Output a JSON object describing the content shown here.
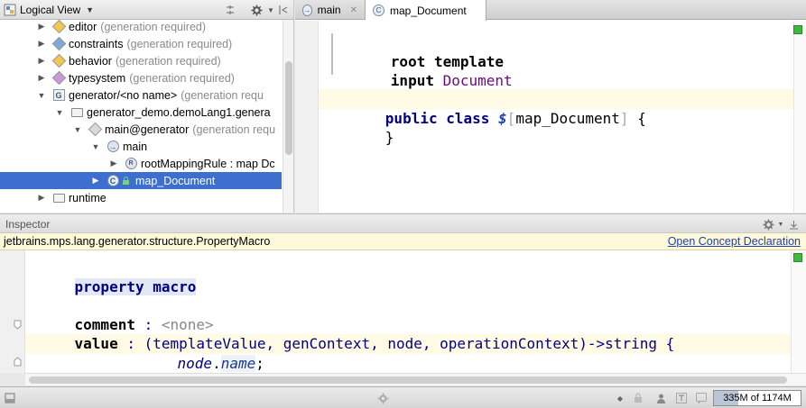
{
  "project": {
    "view_label": "Logical View",
    "tree": [
      {
        "name": "editor",
        "hint": "(generation required)",
        "icon": "module-diamond-icon",
        "badge": "E",
        "color": "#f0c850",
        "state": "collapsed"
      },
      {
        "name": "constraints",
        "hint": "(generation required)",
        "icon": "module-diamond-icon",
        "badge": "C",
        "color": "#7fa8d8",
        "state": "collapsed"
      },
      {
        "name": "behavior",
        "hint": "(generation required)",
        "icon": "module-diamond-icon",
        "badge": "B",
        "color": "#f0c850",
        "state": "collapsed"
      },
      {
        "name": "typesystem",
        "hint": "(generation required)",
        "icon": "module-diamond-icon",
        "badge": "T",
        "color": "#c89ad8",
        "state": "collapsed"
      },
      {
        "name": "generator/<no name>",
        "hint": "(generation requ",
        "icon": "generator-icon",
        "badge": "G",
        "state": "expanded"
      },
      {
        "name": "generator_demo.demoLang1.genera",
        "hint": "",
        "icon": "folder-icon",
        "state": "expanded"
      },
      {
        "name": "main@generator",
        "hint": "(generation requ",
        "icon": "model-diamond-icon",
        "badge": "M",
        "color": "#d9d9d9",
        "state": "expanded"
      },
      {
        "name": "main",
        "hint": "",
        "icon": "mapping-config-icon",
        "badge": "→",
        "state": "expanded"
      },
      {
        "name": "rootMappingRule : map Dc",
        "hint": "",
        "icon": "rule-icon",
        "badge": "R",
        "state": "collapsed"
      },
      {
        "name": "map_Document",
        "hint": "",
        "icon": "class-icon",
        "badge": "C",
        "state": "collapsed"
      },
      {
        "name": "runtime",
        "hint": "",
        "icon": "folder-icon",
        "state": "collapsed"
      }
    ]
  },
  "editor": {
    "tabs": [
      {
        "label": "main",
        "icon": "mapping-config-icon",
        "active": false
      },
      {
        "label": "map_Document",
        "icon": "class-icon",
        "active": true
      }
    ],
    "lines": {
      "l1_kw": "root template",
      "l2_kw": "input",
      "l2_type": "Document",
      "l3_kw": "public class",
      "l3_macro": "$",
      "l3_name": "map_Document",
      "l3_brace": "{",
      "l4": "}"
    }
  },
  "inspector": {
    "title": "Inspector",
    "concept_fqn": "jetbrains.mps.lang.generator.structure.PropertyMacro",
    "open_link": "Open Concept Declaration",
    "code": {
      "heading": "property macro",
      "comment_kw": "comment",
      "colon": ":",
      "comment_val": "<none>",
      "value_kw": "value",
      "signature": "(templateValue, genContext, node, operationContext)->string {",
      "body_node": "node",
      "body_dot": ".",
      "body_field": "name",
      "body_semi": ";",
      "close": "}"
    }
  },
  "status": {
    "encoding_arrow": "◆",
    "memory_used": 335,
    "memory_total": 1174,
    "memory_text": "335M of 1174M"
  },
  "colors": {
    "selection": "#3c6fcf",
    "keyword": "#000080",
    "link": "#2142ae",
    "marker_ok": "#3fb83f"
  }
}
